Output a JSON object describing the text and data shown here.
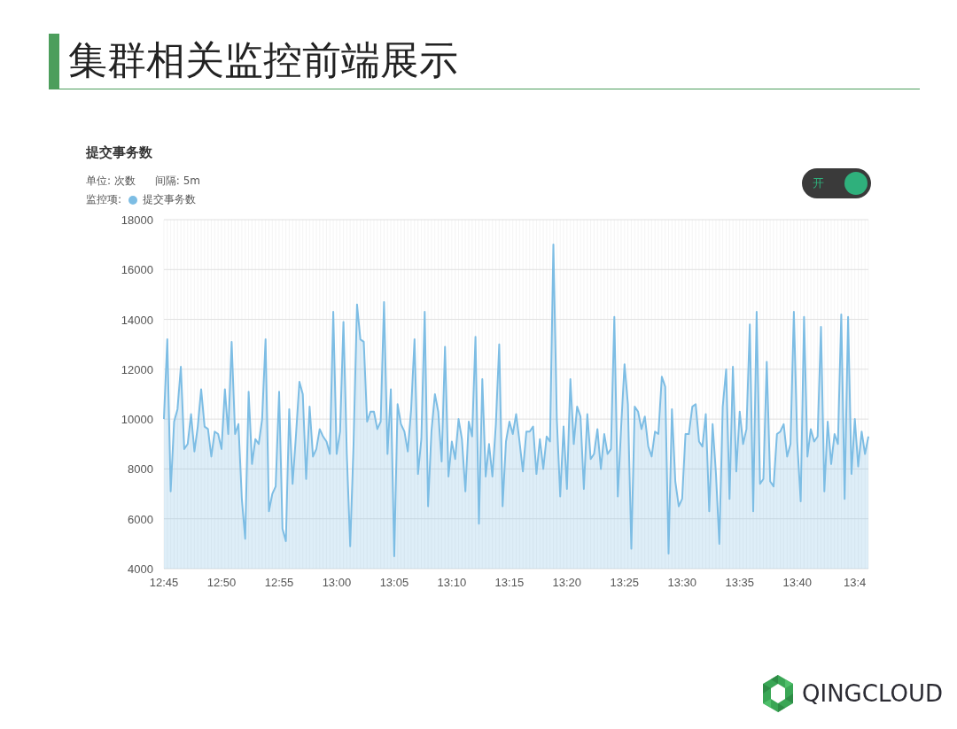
{
  "slide": {
    "title": "集群相关监控前端展示"
  },
  "panel": {
    "title": "提交事务数",
    "unit": "单位: 次数",
    "interval": "间隔: 5m",
    "legend": {
      "label": "监控项:"
    },
    "toggle": {
      "label": "开",
      "on": true
    },
    "chart_data": {
      "type": "area",
      "grid": true,
      "ylim": [
        4000,
        18000
      ],
      "yticks": [
        4000,
        6000,
        8000,
        10000,
        12000,
        14000,
        16000,
        18000
      ],
      "categories": [
        "12:45",
        null,
        null,
        null,
        null,
        null,
        null,
        null,
        null,
        null,
        null,
        null,
        null,
        null,
        null,
        null,
        null,
        "12:50",
        null,
        null,
        null,
        null,
        null,
        null,
        null,
        null,
        null,
        null,
        null,
        null,
        null,
        null,
        null,
        null,
        "12:55",
        null,
        null,
        null,
        null,
        null,
        null,
        null,
        null,
        null,
        null,
        null,
        null,
        null,
        null,
        null,
        null,
        "13:00",
        null,
        null,
        null,
        null,
        null,
        null,
        null,
        null,
        null,
        null,
        null,
        null,
        null,
        null,
        null,
        null,
        "13:05",
        null,
        null,
        null,
        null,
        null,
        null,
        null,
        null,
        null,
        null,
        null,
        null,
        null,
        null,
        null,
        null,
        "13:10",
        null,
        null,
        null,
        null,
        null,
        null,
        null,
        null,
        null,
        null,
        null,
        null,
        null,
        null,
        null,
        null,
        "13:15",
        null,
        null,
        null,
        null,
        null,
        null,
        null,
        null,
        null,
        null,
        null,
        null,
        null,
        null,
        null,
        null,
        "13:20",
        null,
        null,
        null,
        null,
        null,
        null,
        null,
        null,
        null,
        null,
        null,
        null,
        null,
        null,
        null,
        null,
        "13:25",
        null,
        null,
        null,
        null,
        null,
        null,
        null,
        null,
        null,
        null,
        null,
        null,
        null,
        null,
        null,
        null,
        "13:30",
        null,
        null,
        null,
        null,
        null,
        null,
        null,
        null,
        null,
        null,
        null,
        null,
        null,
        null,
        null,
        null,
        "13:35",
        null,
        null,
        null,
        null,
        null,
        null,
        null,
        null,
        null,
        null,
        null,
        null,
        null,
        null,
        null,
        null,
        "13:40",
        null,
        null,
        null,
        null,
        null,
        null,
        null,
        null,
        null,
        null,
        null,
        null,
        null,
        null,
        null,
        null,
        "13:4",
        null,
        null,
        null,
        null
      ],
      "series": [
        {
          "name": "提交事务数",
          "color": "#7dbde4",
          "values": [
            10000,
            13200,
            7100,
            9900,
            10400,
            12100,
            8800,
            9000,
            10200,
            8700,
            9700,
            11200,
            9700,
            9600,
            8500,
            9500,
            9400,
            8800,
            11200,
            9400,
            13100,
            9400,
            9800,
            6800,
            5200,
            11100,
            8200,
            9200,
            9000,
            10000,
            13200,
            6300,
            7000,
            7300,
            11100,
            5600,
            5100,
            10400,
            7400,
            9400,
            11500,
            11000,
            7600,
            10500,
            8500,
            8800,
            9600,
            9300,
            9100,
            8600,
            14300,
            8600,
            9500,
            13900,
            8600,
            4900,
            9000,
            14600,
            13200,
            13100,
            9900,
            10300,
            10300,
            9600,
            9900,
            14700,
            8600,
            11200,
            4500,
            10600,
            9800,
            9500,
            8700,
            10400,
            13200,
            7800,
            9200,
            14300,
            6500,
            9500,
            11000,
            10300,
            8300,
            12900,
            7700,
            9100,
            8400,
            10000,
            9200,
            7100,
            9900,
            9300,
            13300,
            5800,
            11600,
            7700,
            9000,
            7700,
            9800,
            13000,
            6500,
            9100,
            9900,
            9400,
            10200,
            9100,
            7900,
            9500,
            9500,
            9700,
            7800,
            9200,
            8000,
            9300,
            9100,
            17000,
            10000,
            6900,
            9700,
            7200,
            11600,
            9000,
            10500,
            10100,
            7200,
            10200,
            8400,
            8600,
            9600,
            8000,
            9400,
            8600,
            8800,
            14100,
            6900,
            9700,
            12200,
            10600,
            4800,
            10500,
            10300,
            9600,
            10100,
            8900,
            8500,
            9500,
            9400,
            11700,
            11300,
            4600,
            10400,
            7500,
            6500,
            6800,
            9400,
            9400,
            10500,
            10600,
            9100,
            8900,
            10200,
            6300,
            9800,
            7800,
            5000,
            10500,
            12000,
            6800,
            12100,
            7900,
            10300,
            9000,
            9600,
            13800,
            6300,
            14300,
            7400,
            7600,
            12300,
            7500,
            7300,
            9400,
            9500,
            9800,
            8500,
            9000,
            14300,
            9100,
            6700,
            14100,
            8500,
            9600,
            9100,
            9300,
            13700,
            7100,
            9900,
            8200,
            9400,
            9000,
            14200,
            6800,
            14100,
            7800,
            10000,
            8100,
            9500,
            8600,
            9300
          ]
        }
      ]
    }
  },
  "logo": {
    "text": "QINGCLOUD"
  }
}
